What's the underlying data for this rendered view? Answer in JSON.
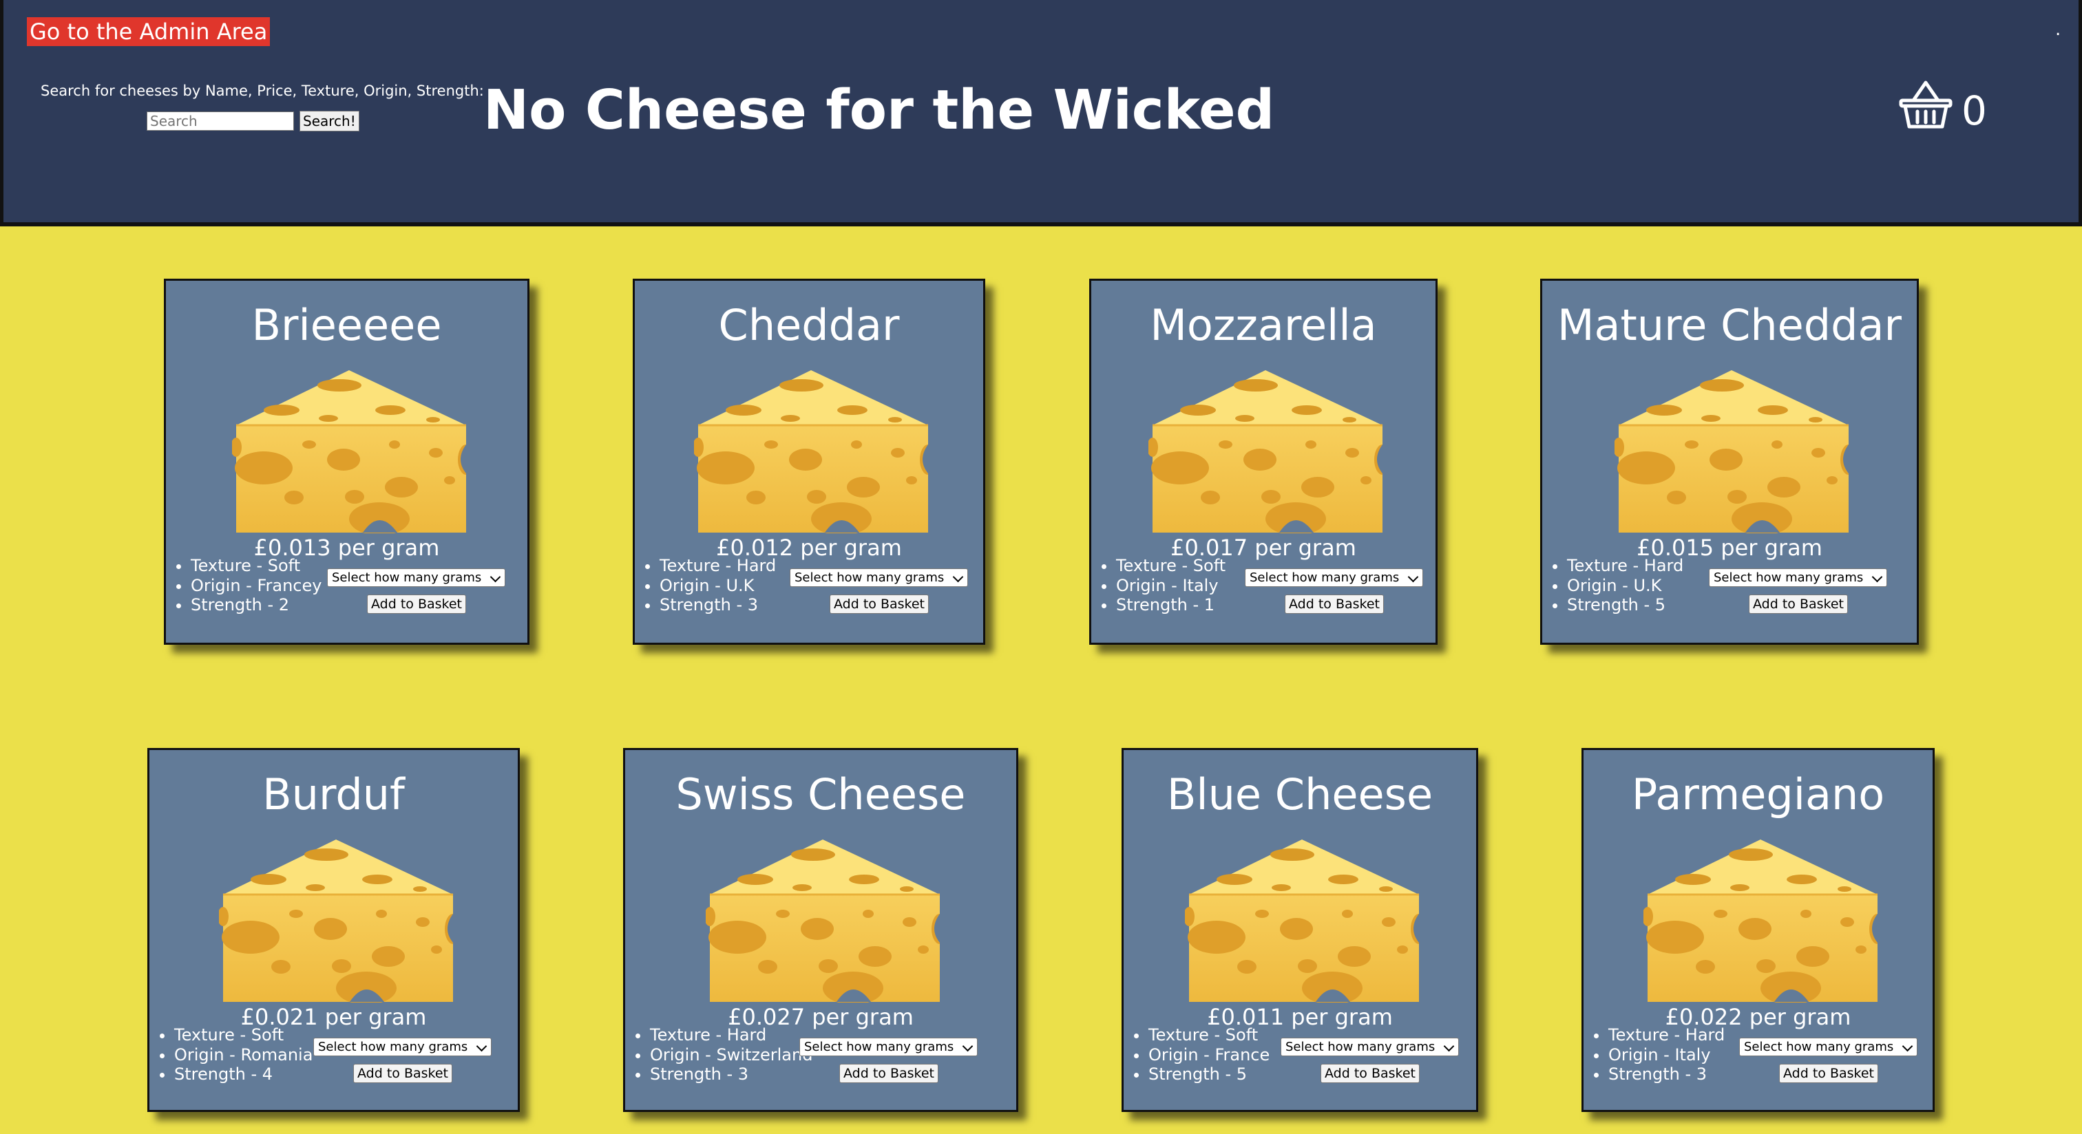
{
  "header": {
    "admin_link": "Go to the Admin Area",
    "search_label": "Search for cheeses by Name, Price, Texture, Origin, Strength:",
    "search_placeholder": "Search",
    "search_button": "Search!",
    "title": "No Cheese for the Wicked",
    "basket_count": "0",
    "corner_dot": "."
  },
  "colors": {
    "header_bg": "#2e3b59",
    "page_bg": "#ebe04a",
    "card_bg": "#627b98",
    "admin_link_bg": "#e0362c"
  },
  "icons": {
    "basket": "basket-icon",
    "cheese": "cheese-wedge-icon"
  },
  "cheeses": [
    {
      "name": "Brieeeee",
      "price": "£0.013 per gram",
      "texture": "Texture - Soft",
      "origin": "Origin - Francey",
      "strength": "Strength - 2",
      "select_label": "Select how many grams",
      "button": "Add to Basket"
    },
    {
      "name": "Cheddar",
      "price": "£0.012 per gram",
      "texture": "Texture - Hard",
      "origin": "Origin - U.K",
      "strength": "Strength - 3",
      "select_label": "Select how many grams",
      "button": "Add to Basket"
    },
    {
      "name": "Mozzarella",
      "price": "£0.017 per gram",
      "texture": "Texture - Soft",
      "origin": "Origin - Italy",
      "strength": "Strength - 1",
      "select_label": "Select how many grams",
      "button": "Add to Basket"
    },
    {
      "name": "Mature Cheddar",
      "price": "£0.015 per gram",
      "texture": "Texture - Hard",
      "origin": "Origin - U.K",
      "strength": "Strength - 5",
      "select_label": "Select how many grams",
      "button": "Add to Basket"
    },
    {
      "name": "Burduf",
      "price": "£0.021 per gram",
      "texture": "Texture - Soft",
      "origin": "Origin - Romania",
      "strength": "Strength - 4",
      "select_label": "Select how many grams",
      "button": "Add to Basket"
    },
    {
      "name": "Swiss Cheese",
      "price": "£0.027 per gram",
      "texture": "Texture - Hard",
      "origin": "Origin - Switzerland",
      "strength": "Strength - 3",
      "select_label": "Select how many grams",
      "button": "Add to Basket"
    },
    {
      "name": "Blue Cheese",
      "price": "£0.011 per gram",
      "texture": "Texture - Soft",
      "origin": "Origin - France",
      "strength": "Strength - 5",
      "select_label": "Select how many grams",
      "button": "Add to Basket"
    },
    {
      "name": "Parmegiano",
      "price": "£0.022 per gram",
      "texture": "Texture - Hard",
      "origin": "Origin - Italy",
      "strength": "Strength - 3",
      "select_label": "Select how many grams",
      "button": "Add to Basket"
    }
  ]
}
